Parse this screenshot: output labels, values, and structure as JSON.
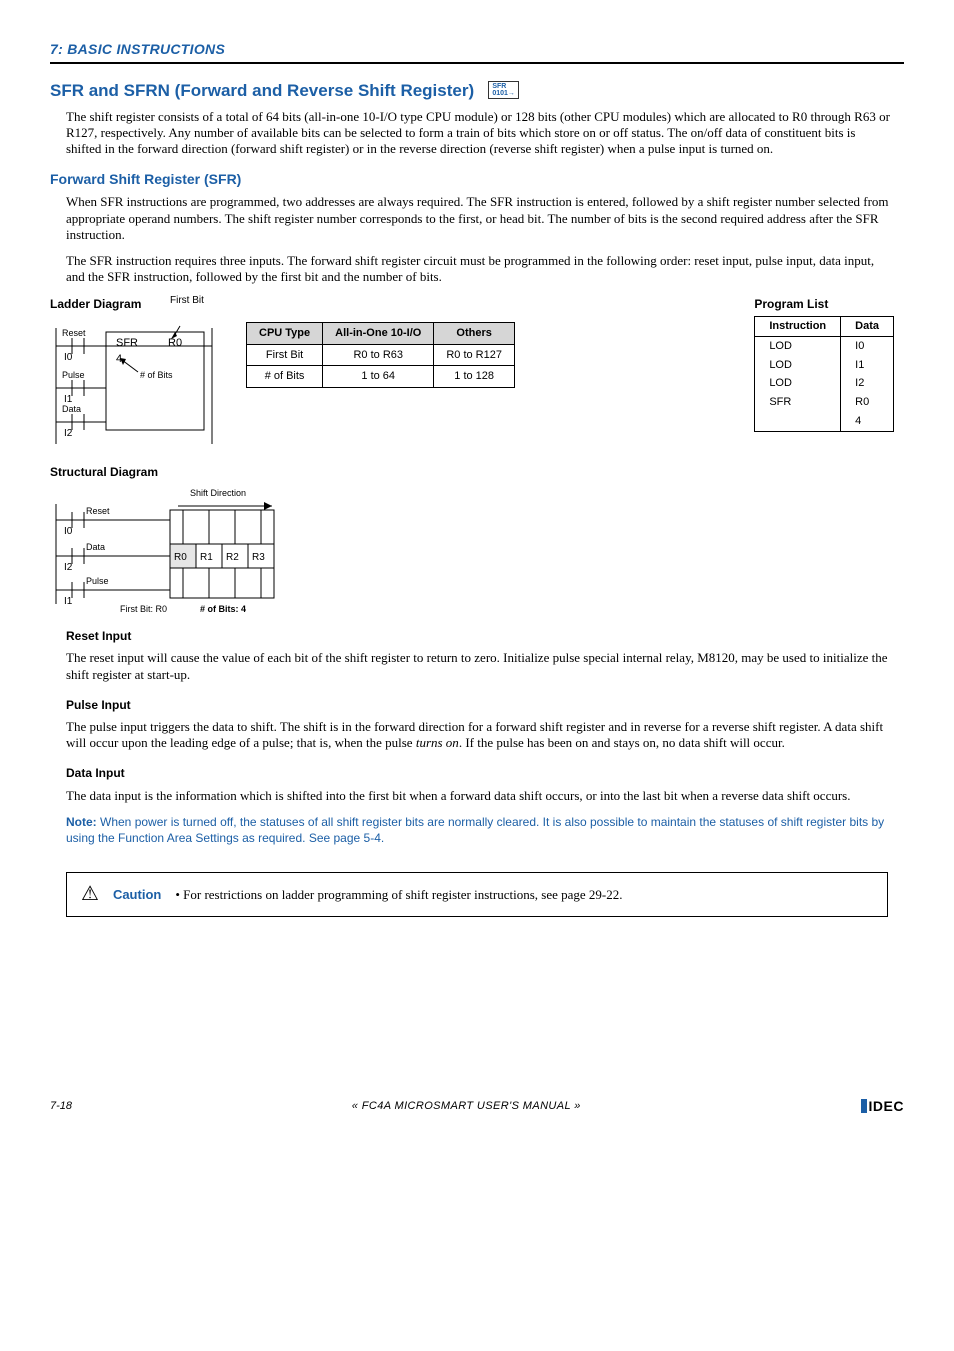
{
  "domain": "Document",
  "chapter_header": "7: BASIC INSTRUCTIONS",
  "section_title": "SFR and SFRN (Forward and Reverse Shift Register)",
  "icon_top": "SFR",
  "icon_bottom": "0101",
  "intro_para": "The shift register consists of a total of 64 bits (all-in-one 10-I/O type CPU module) or 128 bits (other CPU modules) which are allocated to R0 through R63 or R127, respectively. Any number of available bits can be selected to form a train of bits which store on or off status. The on/off data of constituent bits is shifted in the forward direction (forward shift register) or in the reverse direction (reverse shift register) when a pulse input is turned on.",
  "sub_heading": "Forward Shift Register (SFR)",
  "sub_para1": "When SFR instructions are programmed, two addresses are always required. The SFR instruction is entered, followed by a shift register number selected from appropriate operand numbers. The shift register number corresponds to the first, or head bit. The number of bits is the second required address after the SFR instruction.",
  "sub_para2": "The SFR instruction requires three inputs. The forward shift register circuit must be programmed in the following order: reset input, pulse input, data input, and the SFR instruction, followed by the first bit and the number of bits.",
  "ladder_label": "Ladder Diagram",
  "ladder": {
    "first_bit_lbl": "First Bit",
    "reset": "Reset",
    "pulse": "Pulse",
    "data": "Data",
    "i0": "I0",
    "i1": "I1",
    "i2": "I2",
    "sfr": "SFR",
    "r0": "R0",
    "n4": "4",
    "nbits": "# of Bits"
  },
  "cpu_table": {
    "headers": [
      "CPU Type",
      "All-in-One 10-I/O",
      "Others"
    ],
    "rows": [
      [
        "First Bit",
        "R0 to R63",
        "R0 to R127"
      ],
      [
        "# of Bits",
        "1 to 64",
        "1 to 128"
      ]
    ]
  },
  "program_list_label": "Program List",
  "program_list": {
    "headers": [
      "Instruction",
      "Data"
    ],
    "rows": [
      [
        "LOD",
        "I0"
      ],
      [
        "LOD",
        "I1"
      ],
      [
        "LOD",
        "I2"
      ],
      [
        "SFR",
        "R0"
      ],
      [
        "",
        "4"
      ]
    ]
  },
  "struct_label": "Structural Diagram",
  "struct": {
    "shift_dir": "Shift Direction",
    "reset": "Reset",
    "data": "Data",
    "pulse": "Pulse",
    "i0": "I0",
    "i1": "I1",
    "i2": "I2",
    "r0": "R0",
    "r1": "R1",
    "r2": "R2",
    "r3": "R3",
    "first_bit": "First Bit: R0",
    "nbits": "# of Bits: 4"
  },
  "reset_heading": "Reset Input",
  "reset_para": "The reset input will cause the value of each bit of the shift register to return to zero. Initialize pulse special internal relay, M8120, may be used to initialize the shift register at start-up.",
  "pulse_heading": "Pulse Input",
  "pulse_para": "The pulse input triggers the data to shift. The shift is in the forward direction for a forward shift register and in reverse for a reverse shift register. A data shift will occur upon the leading edge of a pulse; that is, when the pulse turns on. If the pulse has been on and stays on, no data shift will occur.",
  "data_heading": "Data Input",
  "data_para": "The data input is the information which is shifted into the first bit when a forward data shift occurs, or into the last bit when a reverse data shift occurs.",
  "note_bold": "Note:",
  "note_text": " When power is turned off, the statuses of all shift register bits are normally cleared. It is also possible to maintain the statuses of shift register bits by using the Function Area Settings as required. See page 5-4.",
  "caution_label": "Caution",
  "caution_bullet": "•",
  "caution_text": " For restrictions on ladder programming of shift register instructions, see page 29-22.",
  "footer_page": "7-18",
  "footer_center": "« FC4A MICROSMART USER'S MANUAL »",
  "footer_logo": "IDEC",
  "chart_data": [
    {
      "type": "table",
      "title": "CPU Type Ranges",
      "columns": [
        "CPU Type",
        "All-in-One 10-I/O",
        "Others"
      ],
      "rows": [
        [
          "First Bit",
          "R0 to R63",
          "R0 to R127"
        ],
        [
          "# of Bits",
          "1 to 64",
          "1 to 128"
        ]
      ]
    },
    {
      "type": "table",
      "title": "Program List",
      "columns": [
        "Instruction",
        "Data"
      ],
      "rows": [
        [
          "LOD",
          "I0"
        ],
        [
          "LOD",
          "I1"
        ],
        [
          "LOD",
          "I2"
        ],
        [
          "SFR",
          "R0"
        ],
        [
          "",
          "4"
        ]
      ]
    }
  ]
}
